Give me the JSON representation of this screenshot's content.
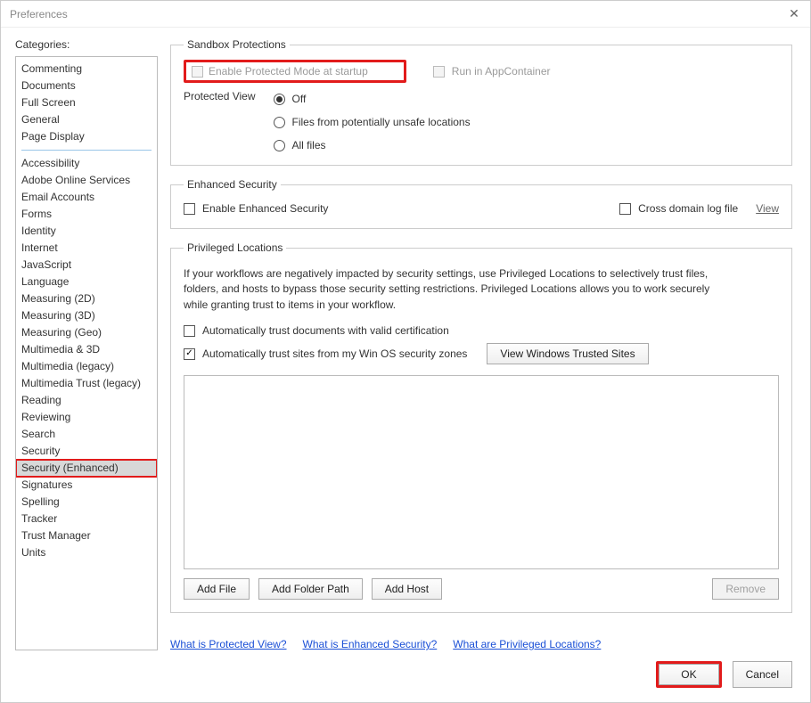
{
  "window": {
    "title": "Preferences"
  },
  "sidebar": {
    "label": "Categories:",
    "groupA": [
      "Commenting",
      "Documents",
      "Full Screen",
      "General",
      "Page Display"
    ],
    "groupB": [
      "Accessibility",
      "Adobe Online Services",
      "Email Accounts",
      "Forms",
      "Identity",
      "Internet",
      "JavaScript",
      "Language",
      "Measuring (2D)",
      "Measuring (3D)",
      "Measuring (Geo)",
      "Multimedia & 3D",
      "Multimedia (legacy)",
      "Multimedia Trust (legacy)",
      "Reading",
      "Reviewing",
      "Search",
      "Security",
      "Security (Enhanced)",
      "Signatures",
      "Spelling",
      "Tracker",
      "Trust Manager",
      "Units"
    ],
    "selected": "Security (Enhanced)"
  },
  "sandbox": {
    "legend": "Sandbox Protections",
    "protectedMode": "Enable Protected Mode at startup",
    "runApp": "Run in AppContainer",
    "pvLabel": "Protected View",
    "pvOff": "Off",
    "pvUnsafe": "Files from potentially unsafe locations",
    "pvAll": "All files"
  },
  "enhanced": {
    "legend": "Enhanced Security",
    "enable": "Enable Enhanced Security",
    "crosslog": "Cross domain log file",
    "view": "View"
  },
  "priv": {
    "legend": "Privileged Locations",
    "desc": "If your workflows are negatively impacted by security settings, use Privileged Locations to selectively trust files, folders, and hosts to bypass those security setting restrictions. Privileged Locations allows you to work securely while granting trust to items in your workflow.",
    "autoCert": "Automatically trust documents with valid certification",
    "autoWin": "Automatically trust sites from my Win OS security zones",
    "viewWinBtn": "View Windows Trusted Sites",
    "addFile": "Add File",
    "addFolder": "Add Folder Path",
    "addHost": "Add Host",
    "remove": "Remove"
  },
  "links": {
    "pv": "What is Protected View?",
    "es": "What is Enhanced Security?",
    "pl": "What are Privileged Locations?"
  },
  "footer": {
    "ok": "OK",
    "cancel": "Cancel"
  }
}
